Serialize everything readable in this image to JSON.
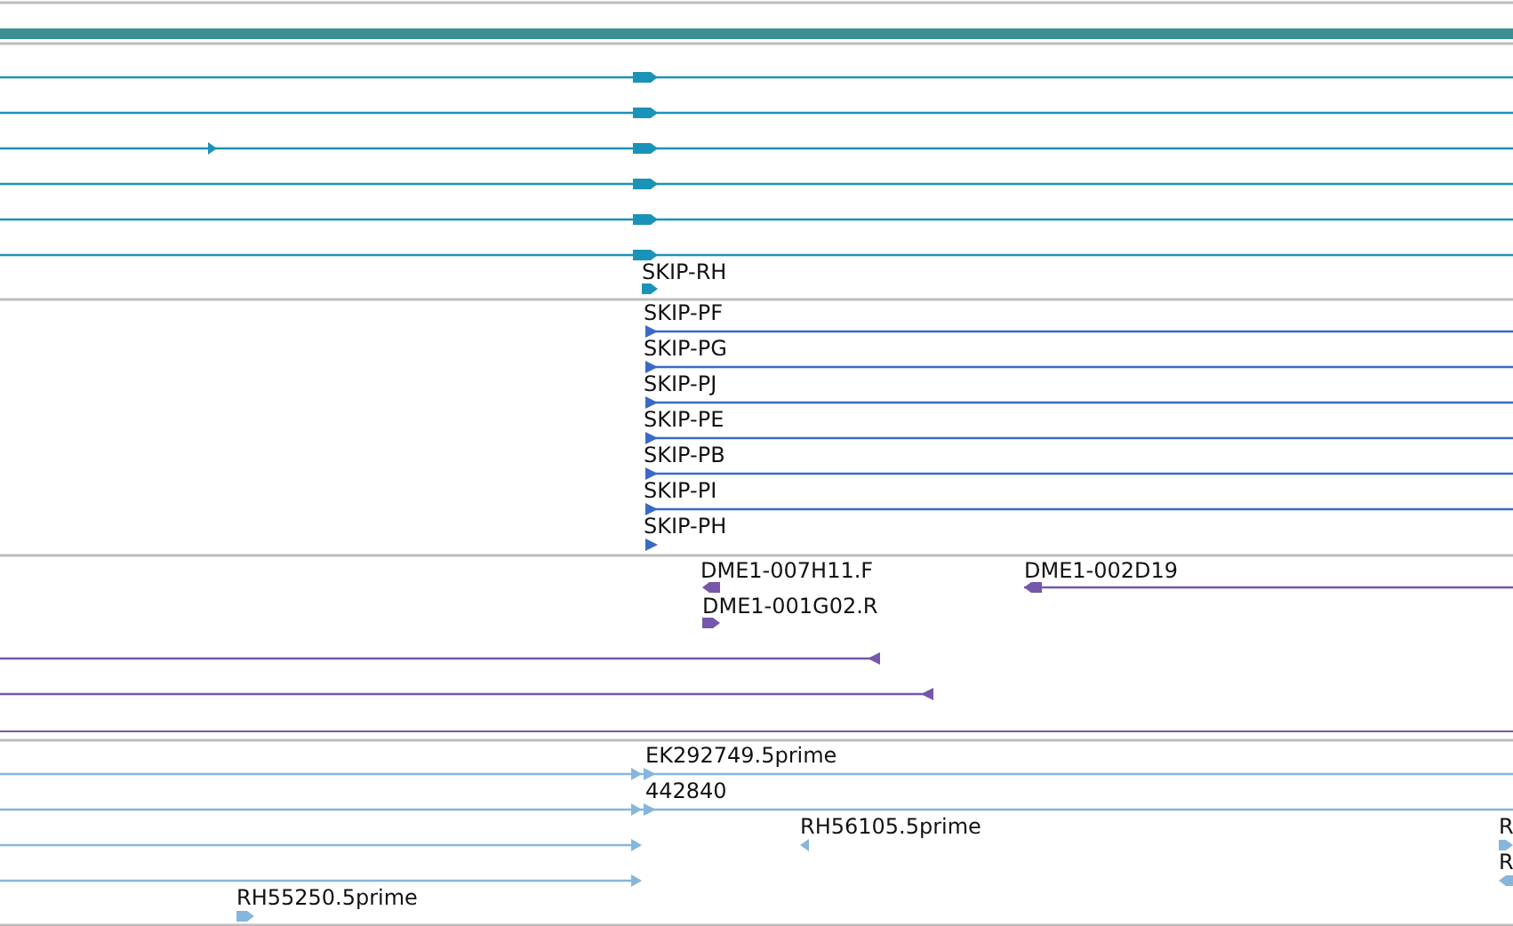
{
  "tracks": [
    {
      "color": "#3d8f8f",
      "features": [
        {
          "kind": "bar"
        }
      ]
    },
    {
      "color": "#1a93b8",
      "features": [
        {
          "reverse": false
        },
        {
          "reverse": false
        },
        {
          "reverse": false
        },
        {
          "reverse": false
        },
        {
          "reverse": false
        },
        {
          "reverse": false
        },
        {
          "label": "SKIP-RH",
          "reverse": false
        }
      ]
    },
    {
      "color": "#3a6ac8",
      "features": [
        {
          "label": "SKIP-PF",
          "reverse": false
        },
        {
          "label": "SKIP-PG",
          "reverse": false
        },
        {
          "label": "SKIP-PJ",
          "reverse": false
        },
        {
          "label": "SKIP-PE",
          "reverse": false
        },
        {
          "label": "SKIP-PB",
          "reverse": false
        },
        {
          "label": "SKIP-PI",
          "reverse": false
        },
        {
          "label": "SKIP-PH",
          "reverse": false
        }
      ]
    },
    {
      "color": "#7657aa",
      "features": [
        {
          "label": "DME1-007H11.F",
          "reverse": true
        },
        {
          "label": "DME1-002D19",
          "reverse": true
        },
        {
          "label": "DME1-001G02.R",
          "reverse": false
        },
        {
          "reverse": true
        },
        {
          "reverse": true
        }
      ]
    },
    {
      "color": "#86b6dc",
      "features": [
        {
          "label": "EK292749.5prime",
          "reverse": false
        },
        {
          "label": "442840",
          "reverse": false
        },
        {
          "label": "RH56105.5prime",
          "reverse": true
        },
        {
          "reverse": false
        },
        {
          "reverse": false
        },
        {
          "label": "R",
          "reverse": false
        },
        {
          "label": "R",
          "reverse": true
        },
        {
          "label": "RH55250.5prime",
          "reverse": false
        }
      ]
    }
  ]
}
